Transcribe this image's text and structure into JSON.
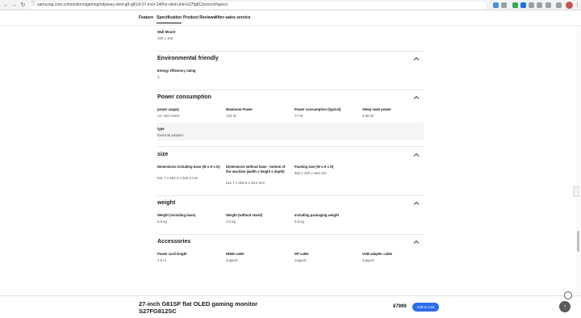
{
  "browser": {
    "url": "samsung.com.cn/monitors/gaming/odyssey-oled-g8-g81sf-27-inch-240hz-oled-uhd-ls27fg812sxxcn/#specs",
    "back_icon": "arrow-left-icon",
    "forward_icon": "arrow-right-icon",
    "reload_icon": "reload-icon"
  },
  "subnav": {
    "tabs": [
      {
        "label": "Feature"
      },
      {
        "label": "Specification"
      },
      {
        "label": "Product Reviews"
      },
      {
        "label": "After-sales service"
      }
    ],
    "active_tab": "Specification"
  },
  "wall_mount": {
    "label": "Wall Mount",
    "value": "100 x 100"
  },
  "sections": {
    "environmental": {
      "title": "Environmental friendly",
      "items": [
        {
          "label": "Energy efficiency rating",
          "value": "3"
        }
      ]
    },
    "power": {
      "title": "Power consumption",
      "items": [
        {
          "label": "power supply",
          "value": "AC 100~240V"
        },
        {
          "label": "Maximum Power",
          "value": "143 W"
        },
        {
          "label": "Power consumption (typical)",
          "value": "77 W"
        },
        {
          "label": "Sleep state power",
          "value": "0.80 W"
        },
        {
          "label": "type",
          "value": "External adapter"
        }
      ]
    },
    "size": {
      "title": "size",
      "items": [
        {
          "label": "Dimensions including base (W x H x D)",
          "value": "611.7 x 554.2 x 263.3 mm"
        },
        {
          "label": "Dimensions without base - bottom of the machine (width x height x depth)",
          "value": "611.7 x 353.8 x 49.2 mm"
        },
        {
          "label": "Packing size (W x H x D)",
          "value": "684 x 200 x 464 mm"
        }
      ]
    },
    "weight": {
      "title": "weight",
      "items": [
        {
          "label": "Weight (including base)",
          "value": "6.9 kg"
        },
        {
          "label": "Weight (without stand)",
          "value": "3.8 kg"
        },
        {
          "label": "Including packaging weight",
          "value": "9.5 kg"
        }
      ]
    },
    "accessories": {
      "title": "Accessories",
      "items": [
        {
          "label": "Power cord length",
          "value": "1.5 m"
        },
        {
          "label": "HDMI cable",
          "value": "support"
        },
        {
          "label": "DP cable",
          "value": "support"
        },
        {
          "label": "USB adapter cable",
          "value": "support"
        }
      ]
    }
  },
  "bottom_bar": {
    "product_title": "27-inch G81SF flat OLED gaming monitor",
    "model": "S27FG812SC",
    "price": "¥7999",
    "add_to_cart": "Add to Cart"
  },
  "colors": {
    "accent": "#2b6de8",
    "text": "#1a1a1a",
    "muted": "#555555"
  }
}
